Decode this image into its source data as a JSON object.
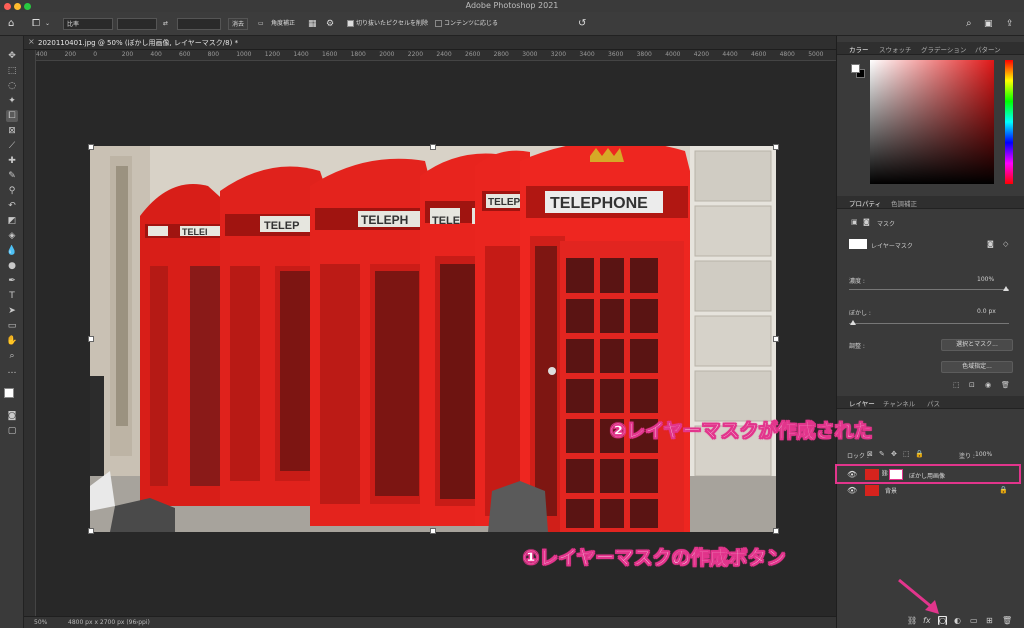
{
  "window": {
    "title": "Adobe Photoshop 2021"
  },
  "options_bar": {
    "ratio_label": "比率",
    "clear_label": "消去",
    "straighten_label": "角度補正",
    "delete_cropped_label": "切り抜いたピクセルを削除",
    "content_aware_label": "コンテンツに応じる"
  },
  "document": {
    "tab_title": "2020110401.jpg @ 50% (ぼかし用画像, レイヤーマスク/8) *",
    "ruler_ticks": [
      "400",
      "200",
      "0",
      "200",
      "400",
      "600",
      "800",
      "1000",
      "1200",
      "1400",
      "1600",
      "1800",
      "2000",
      "2200",
      "2400",
      "2600",
      "2800",
      "3000",
      "3200",
      "3400",
      "3600",
      "3800",
      "4000",
      "4200",
      "4400",
      "4600",
      "4800",
      "5000",
      "5200"
    ],
    "booth_signs": [
      "TELEPHONE",
      "TELEPH",
      "TELEP",
      "TELE",
      "TELEI",
      "TELEP"
    ]
  },
  "status": {
    "zoom": "50%",
    "size": "4800 px x 2700 px (96 ppi)"
  },
  "color_panel": {
    "tabs": [
      "カラー",
      "スウォッチ",
      "グラデーション",
      "パターン"
    ]
  },
  "properties_panel": {
    "tabs": [
      "プロパティ",
      "色調補正"
    ],
    "section": "マスク",
    "mask_type": "レイヤーマスク",
    "density_label": "濃度 :",
    "density_value": "100%",
    "feather_label": "ぼかし :",
    "feather_value": "0.0 px",
    "refine_label": "調整 :",
    "select_mask_button": "選択とマスク...",
    "color_range_button": "色域指定..."
  },
  "layers_panel": {
    "tabs": [
      "レイヤー",
      "チャンネル",
      "パス"
    ],
    "lock_label": "ロック :",
    "fill_label": "塗り :",
    "fill_value": "100%",
    "layers": [
      {
        "name": "ぼかし用画像"
      },
      {
        "name": "背景"
      }
    ]
  },
  "annotations": {
    "created": "②レイヤーマスクが作成された",
    "button": "①レイヤーマスクの作成ボタン"
  },
  "colors": {
    "accent": "#e2358c",
    "booth_red": "#e8231f"
  }
}
